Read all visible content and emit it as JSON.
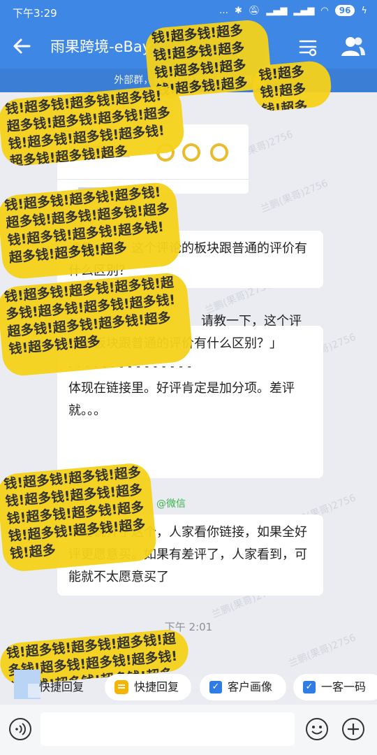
{
  "status_bar": {
    "time": "下午3:29",
    "signal_dots": "…",
    "battery": "96"
  },
  "header": {
    "title": "雨果跨境-eBay",
    "subtitle": "外部群，含95位外部联系人 | 群主"
  },
  "watermark": "兰鹏(果哥)2756",
  "redaction_text": "钱!超多钱!超多钱!超多钱!超多钱!超多钱!超多钱!超多钱!超多钱!超多钱!超多钱!超多钱!超多钱!超多",
  "messages": {
    "question": "请教一下，这个评论的板块跟普通的评价有什么区别？",
    "reply_quote": "请教一下，这个评论的板块跟普通的评价有什么区别？」",
    "reply_divider": "- - - - - - - - - - - - - - -",
    "reply_body": "体现在链接里。好评肯定是加分项。差评就。。。",
    "sender_tag": "@微信",
    "third": "就是说开了这个，人家看你链接，如果全好评更愿意买。如果有差评了，人家看到，可能就不太愿意买了",
    "timestamp": "下午 2:01"
  },
  "quick_actions": {
    "reply1": "快捷回复",
    "reply2": "快捷回复",
    "portrait": "客户画像",
    "one_code": "一客一码"
  },
  "colors": {
    "header": "#3f87e4",
    "chat_bg": "#eaecf1",
    "redaction": "#f5d21b",
    "sender": "#3cb24a"
  }
}
